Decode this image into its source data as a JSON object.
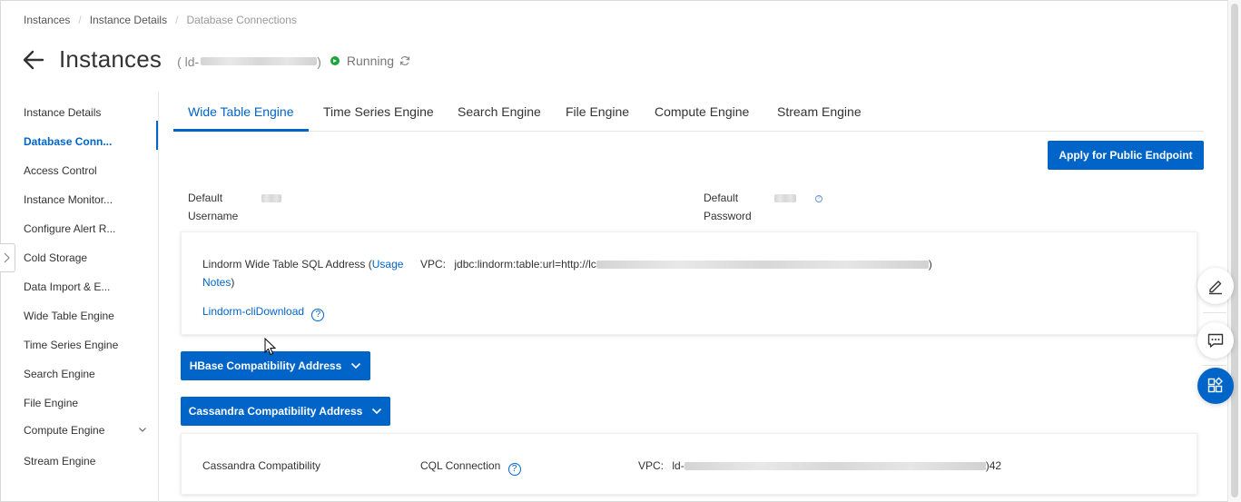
{
  "breadcrumb": [
    {
      "label": "Instances"
    },
    {
      "label": "Instance Details"
    },
    {
      "label": "Database Connections"
    }
  ],
  "header": {
    "title": "Instances",
    "id_prefix": "( ld-",
    "id_suffix": " )",
    "status": "Running",
    "status_color": "#1ea53a",
    "icons": {
      "back": "back-arrow-icon",
      "refresh": "refresh-icon"
    }
  },
  "sidebar": {
    "items": [
      {
        "label": "Instance Details"
      },
      {
        "label": "Database Conn..."
      },
      {
        "label": "Access Control"
      },
      {
        "label": "Instance Monitor..."
      },
      {
        "label": "Configure Alert R..."
      },
      {
        "label": "Cold Storage"
      },
      {
        "label": "Data Import & E..."
      },
      {
        "label": "Wide Table Engine"
      },
      {
        "label": "Time Series Engine"
      },
      {
        "label": "Search Engine"
      },
      {
        "label": "File Engine"
      },
      {
        "label": "Compute Engine"
      },
      {
        "label": "Stream Engine"
      }
    ],
    "active_index": 1
  },
  "tabs": [
    {
      "label": "Wide Table Engine"
    },
    {
      "label": "Time Series Engine"
    },
    {
      "label": "Search Engine"
    },
    {
      "label": "File Engine"
    },
    {
      "label": "Compute Engine"
    },
    {
      "label": "Stream Engine"
    }
  ],
  "actions": {
    "apply_public": "Apply for Public Endpoint"
  },
  "credentials": {
    "username_label_1": "Default",
    "username_label_2": "Username",
    "password_label_1": "Default",
    "password_label_2": "Password"
  },
  "sql_panel": {
    "label_prefix": "Lindorm Wide Table SQL Address (",
    "usage_link_1": "Usage",
    "usage_link_2": "Notes",
    "label_suffix": ")",
    "download_link": "Lindorm-cliDownload",
    "vpc_label": "VPC:",
    "vpc_value_prefix": "jdbc:lindorm:table:url=http://lc",
    "vpc_value_suffix": ")"
  },
  "hbase_button": "HBase Compatibility Address",
  "cassandra_button": "Cassandra Compatibility Address",
  "cassandra_panel": {
    "label": "Cassandra Compatibility",
    "cql_label": "CQL Connection",
    "vpc_label": "VPC:",
    "vpc_value_prefix": "ld-",
    "vpc_value_suffix": ")42"
  },
  "colors": {
    "accent": "#0064c8",
    "text": "#333333",
    "muted": "#999999"
  },
  "floating": {
    "icons": [
      "edit-icon",
      "feedback-icon",
      "apps-icon"
    ]
  }
}
